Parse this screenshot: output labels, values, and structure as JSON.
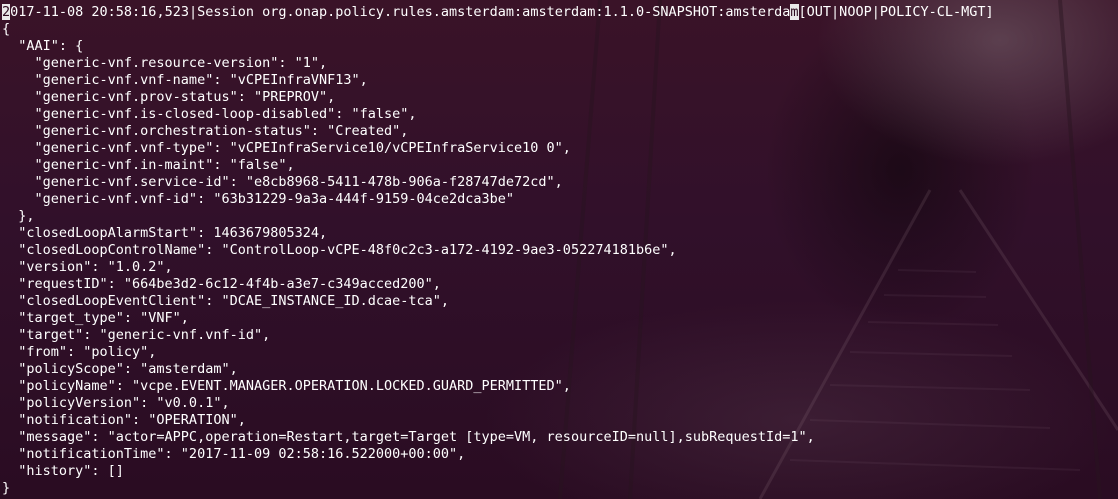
{
  "terminal": {
    "header": {
      "cursor_char": "2",
      "prefix": "017-11-08 20:58:16,523|Session org.onap.policy.rules.amsterdam:amsterdam:1.1.0-SNAPSHOT:amsterda",
      "selected_char": "m",
      "suffix": "[OUT|NOOP|POLICY-CL-MGT]"
    },
    "lines": [
      "{",
      "  \"AAI\": {",
      "    \"generic-vnf.resource-version\": \"1\",",
      "    \"generic-vnf.vnf-name\": \"vCPEInfraVNF13\",",
      "    \"generic-vnf.prov-status\": \"PREPROV\",",
      "    \"generic-vnf.is-closed-loop-disabled\": \"false\",",
      "    \"generic-vnf.orchestration-status\": \"Created\",",
      "    \"generic-vnf.vnf-type\": \"vCPEInfraService10/vCPEInfraService10 0\",",
      "    \"generic-vnf.in-maint\": \"false\",",
      "    \"generic-vnf.service-id\": \"e8cb8968-5411-478b-906a-f28747de72cd\",",
      "    \"generic-vnf.vnf-id\": \"63b31229-9a3a-444f-9159-04ce2dca3be\"",
      "  },",
      "  \"closedLoopAlarmStart\": 1463679805324,",
      "  \"closedLoopControlName\": \"ControlLoop-vCPE-48f0c2c3-a172-4192-9ae3-052274181b6e\",",
      "  \"version\": \"1.0.2\",",
      "  \"requestID\": \"664be3d2-6c12-4f4b-a3e7-c349acced200\",",
      "  \"closedLoopEventClient\": \"DCAE_INSTANCE_ID.dcae-tca\",",
      "  \"target_type\": \"VNF\",",
      "  \"target\": \"generic-vnf.vnf-id\",",
      "  \"from\": \"policy\",",
      "  \"policyScope\": \"amsterdam\",",
      "  \"policyName\": \"vcpe.EVENT.MANAGER.OPERATION.LOCKED.GUARD_PERMITTED\",",
      "  \"policyVersion\": \"v0.0.1\",",
      "  \"notification\": \"OPERATION\",",
      "  \"message\": \"actor=APPC,operation=Restart,target=Target [type=VM, resourceID=null],subRequestId=1\",",
      "  \"notificationTime\": \"2017-11-09 02:58:16.522000+00:00\",",
      "  \"history\": []",
      "}"
    ]
  }
}
